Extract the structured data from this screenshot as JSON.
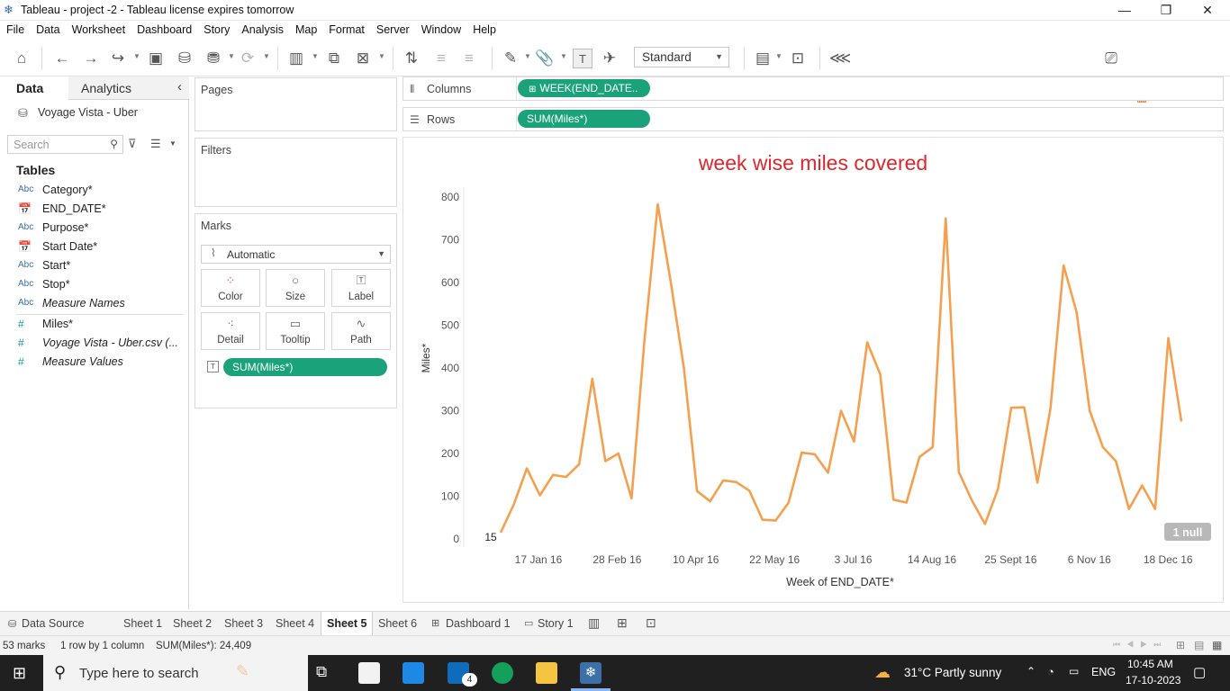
{
  "window": {
    "title": "Tableau - project -2 - Tableau license expires tomorrow"
  },
  "menu": [
    "File",
    "Data",
    "Worksheet",
    "Dashboard",
    "Story",
    "Analysis",
    "Map",
    "Format",
    "Server",
    "Window",
    "Help"
  ],
  "toolbar": {
    "fit_value": "Standard",
    "show_me_label": "Show Me"
  },
  "data_pane": {
    "tab_data": "Data",
    "tab_analytics": "Analytics",
    "datasource": "Voyage Vista - Uber",
    "search_placeholder": "Search",
    "tables_heading": "Tables",
    "fields": [
      {
        "type": "Abc",
        "name": "Category*"
      },
      {
        "type": "date",
        "name": "END_DATE*"
      },
      {
        "type": "Abc",
        "name": "Purpose*"
      },
      {
        "type": "date",
        "name": "Start Date*"
      },
      {
        "type": "Abc",
        "name": "Start*"
      },
      {
        "type": "Abc",
        "name": "Stop*"
      },
      {
        "type": "Abc",
        "name": "Measure Names"
      },
      {
        "type": "#",
        "name": "Miles*"
      },
      {
        "type": "#",
        "name": "Voyage Vista - Uber.csv (..."
      },
      {
        "type": "#",
        "name": "Measure Values"
      }
    ]
  },
  "cards": {
    "pages": "Pages",
    "filters": "Filters",
    "marks": "Marks",
    "mark_type": "Automatic",
    "buttons": [
      "Color",
      "Size",
      "Label",
      "Detail",
      "Tooltip",
      "Path"
    ],
    "marks_pill": "SUM(Miles*)"
  },
  "shelves": {
    "columns_label": "Columns",
    "columns_pill": "WEEK(END_DATE..",
    "rows_label": "Rows",
    "rows_pill": "SUM(Miles*)"
  },
  "chart_data": {
    "type": "line",
    "title": "week wise miles covered",
    "xlabel": "Week of END_DATE*",
    "ylabel": "Miles*",
    "ylim": [
      0,
      800
    ],
    "yticks": [
      "0",
      "100",
      "200",
      "300",
      "400",
      "500",
      "600",
      "700",
      "800"
    ],
    "xticks": [
      "17 Jan 16",
      "28 Feb 16",
      "10 Apr 16",
      "22 May 16",
      "3 Jul 16",
      "14 Aug 16",
      "25 Sept 16",
      "6 Nov 16",
      "18 Dec 16"
    ],
    "first_point_label": "15",
    "null_indicator": "1 null",
    "line_color": "#f5a04e",
    "values": [
      15,
      80,
      165,
      102,
      150,
      145,
      175,
      375,
      182,
      200,
      95,
      470,
      783,
      600,
      400,
      112,
      88,
      137,
      133,
      113,
      45,
      43,
      85,
      202,
      198,
      155,
      300,
      228,
      460,
      385,
      92,
      85,
      192,
      215,
      750,
      157,
      90,
      35,
      118,
      307,
      308,
      132,
      305,
      640,
      530,
      300,
      215,
      182,
      70,
      125,
      70,
      470,
      275
    ]
  },
  "sheet_tabs": {
    "datasource": "Data Source",
    "tabs": [
      "Sheet 1",
      "Sheet 2",
      "Sheet 3",
      "Sheet 4",
      "Sheet 5",
      "Sheet 6"
    ],
    "active": "Sheet 5",
    "dashboard": "Dashboard 1",
    "story": "Story 1"
  },
  "status": {
    "marks": "53 marks",
    "rows_cols": "1 row by 1 column",
    "sum": "SUM(Miles*): 24,409"
  },
  "taskbar": {
    "search_placeholder": "Type here to search",
    "weather": "31°C  Partly sunny",
    "lang": "ENG",
    "time": "10:45 AM",
    "date": "17-10-2023",
    "mail_badge": "4"
  }
}
